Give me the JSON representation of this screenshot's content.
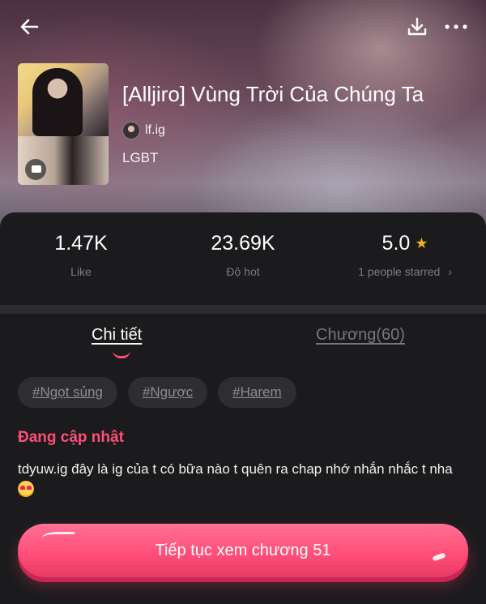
{
  "header": {
    "back_icon": "arrow-left-icon",
    "download_icon": "download-icon",
    "more_icon": "more-horizontal-icon"
  },
  "book": {
    "title": "[Alljiro] Vùng Trời Của Chúng Ta",
    "author": "lf.ig",
    "genre": "LGBT"
  },
  "stats": {
    "likes_value": "1.47K",
    "likes_label": "Like",
    "hot_value": "23.69K",
    "hot_label": "Độ hot",
    "rating_value": "5.0",
    "rating_label": "1 people starred",
    "rating_chevron": "›"
  },
  "tabs": {
    "detail": "Chi tiết",
    "chapters": "Chương(60)"
  },
  "tags": [
    "#Ngọt sủng",
    "#Ngược",
    "#Harem"
  ],
  "status": "Đang cập nhật",
  "description": "tdyuw.ig đây là ig của t có bữa nào t quên ra chap nhớ nhắn nhắc t nha",
  "cta": {
    "label": "Tiếp tục xem chương 51"
  },
  "colors": {
    "accent": "#ff4f7a",
    "star": "#f6b21b",
    "background": "#1b1b1d"
  }
}
